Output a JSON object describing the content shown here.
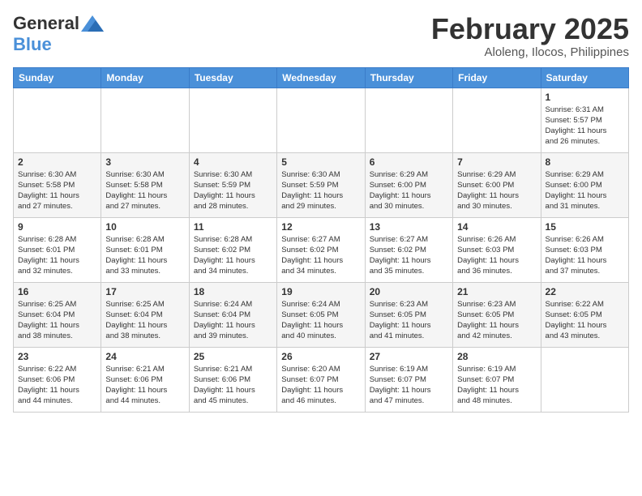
{
  "header": {
    "logo_general": "General",
    "logo_blue": "Blue",
    "month_title": "February 2025",
    "location": "Aloleng, Ilocos, Philippines"
  },
  "days_of_week": [
    "Sunday",
    "Monday",
    "Tuesday",
    "Wednesday",
    "Thursday",
    "Friday",
    "Saturday"
  ],
  "weeks": [
    [
      {
        "day": "",
        "info": ""
      },
      {
        "day": "",
        "info": ""
      },
      {
        "day": "",
        "info": ""
      },
      {
        "day": "",
        "info": ""
      },
      {
        "day": "",
        "info": ""
      },
      {
        "day": "",
        "info": ""
      },
      {
        "day": "1",
        "info": "Sunrise: 6:31 AM\nSunset: 5:57 PM\nDaylight: 11 hours\nand 26 minutes."
      }
    ],
    [
      {
        "day": "2",
        "info": "Sunrise: 6:30 AM\nSunset: 5:58 PM\nDaylight: 11 hours\nand 27 minutes."
      },
      {
        "day": "3",
        "info": "Sunrise: 6:30 AM\nSunset: 5:58 PM\nDaylight: 11 hours\nand 27 minutes."
      },
      {
        "day": "4",
        "info": "Sunrise: 6:30 AM\nSunset: 5:59 PM\nDaylight: 11 hours\nand 28 minutes."
      },
      {
        "day": "5",
        "info": "Sunrise: 6:30 AM\nSunset: 5:59 PM\nDaylight: 11 hours\nand 29 minutes."
      },
      {
        "day": "6",
        "info": "Sunrise: 6:29 AM\nSunset: 6:00 PM\nDaylight: 11 hours\nand 30 minutes."
      },
      {
        "day": "7",
        "info": "Sunrise: 6:29 AM\nSunset: 6:00 PM\nDaylight: 11 hours\nand 30 minutes."
      },
      {
        "day": "8",
        "info": "Sunrise: 6:29 AM\nSunset: 6:00 PM\nDaylight: 11 hours\nand 31 minutes."
      }
    ],
    [
      {
        "day": "9",
        "info": "Sunrise: 6:28 AM\nSunset: 6:01 PM\nDaylight: 11 hours\nand 32 minutes."
      },
      {
        "day": "10",
        "info": "Sunrise: 6:28 AM\nSunset: 6:01 PM\nDaylight: 11 hours\nand 33 minutes."
      },
      {
        "day": "11",
        "info": "Sunrise: 6:28 AM\nSunset: 6:02 PM\nDaylight: 11 hours\nand 34 minutes."
      },
      {
        "day": "12",
        "info": "Sunrise: 6:27 AM\nSunset: 6:02 PM\nDaylight: 11 hours\nand 34 minutes."
      },
      {
        "day": "13",
        "info": "Sunrise: 6:27 AM\nSunset: 6:02 PM\nDaylight: 11 hours\nand 35 minutes."
      },
      {
        "day": "14",
        "info": "Sunrise: 6:26 AM\nSunset: 6:03 PM\nDaylight: 11 hours\nand 36 minutes."
      },
      {
        "day": "15",
        "info": "Sunrise: 6:26 AM\nSunset: 6:03 PM\nDaylight: 11 hours\nand 37 minutes."
      }
    ],
    [
      {
        "day": "16",
        "info": "Sunrise: 6:25 AM\nSunset: 6:04 PM\nDaylight: 11 hours\nand 38 minutes."
      },
      {
        "day": "17",
        "info": "Sunrise: 6:25 AM\nSunset: 6:04 PM\nDaylight: 11 hours\nand 38 minutes."
      },
      {
        "day": "18",
        "info": "Sunrise: 6:24 AM\nSunset: 6:04 PM\nDaylight: 11 hours\nand 39 minutes."
      },
      {
        "day": "19",
        "info": "Sunrise: 6:24 AM\nSunset: 6:05 PM\nDaylight: 11 hours\nand 40 minutes."
      },
      {
        "day": "20",
        "info": "Sunrise: 6:23 AM\nSunset: 6:05 PM\nDaylight: 11 hours\nand 41 minutes."
      },
      {
        "day": "21",
        "info": "Sunrise: 6:23 AM\nSunset: 6:05 PM\nDaylight: 11 hours\nand 42 minutes."
      },
      {
        "day": "22",
        "info": "Sunrise: 6:22 AM\nSunset: 6:05 PM\nDaylight: 11 hours\nand 43 minutes."
      }
    ],
    [
      {
        "day": "23",
        "info": "Sunrise: 6:22 AM\nSunset: 6:06 PM\nDaylight: 11 hours\nand 44 minutes."
      },
      {
        "day": "24",
        "info": "Sunrise: 6:21 AM\nSunset: 6:06 PM\nDaylight: 11 hours\nand 44 minutes."
      },
      {
        "day": "25",
        "info": "Sunrise: 6:21 AM\nSunset: 6:06 PM\nDaylight: 11 hours\nand 45 minutes."
      },
      {
        "day": "26",
        "info": "Sunrise: 6:20 AM\nSunset: 6:07 PM\nDaylight: 11 hours\nand 46 minutes."
      },
      {
        "day": "27",
        "info": "Sunrise: 6:19 AM\nSunset: 6:07 PM\nDaylight: 11 hours\nand 47 minutes."
      },
      {
        "day": "28",
        "info": "Sunrise: 6:19 AM\nSunset: 6:07 PM\nDaylight: 11 hours\nand 48 minutes."
      },
      {
        "day": "",
        "info": ""
      }
    ]
  ]
}
